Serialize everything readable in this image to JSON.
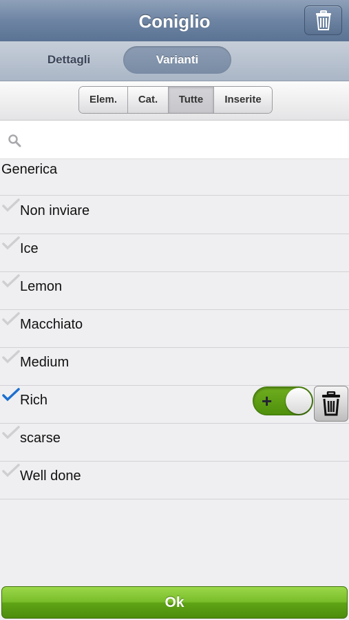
{
  "navbar": {
    "title": "Coniglio",
    "trash_icon": "trash-icon"
  },
  "tabs": [
    {
      "label": "Dettagli",
      "selected": false
    },
    {
      "label": "Varianti",
      "selected": true
    }
  ],
  "filters": [
    {
      "label": "Elem.",
      "selected": false
    },
    {
      "label": "Cat.",
      "selected": false
    },
    {
      "label": "Tutte",
      "selected": true
    },
    {
      "label": "Inserite",
      "selected": false
    }
  ],
  "search": {
    "placeholder": "",
    "value": "",
    "icon": "search-icon"
  },
  "category": {
    "title": "Generica"
  },
  "items": [
    {
      "label": "Non inviare",
      "checked": false
    },
    {
      "label": "Ice",
      "checked": false
    },
    {
      "label": "Lemon",
      "checked": false
    },
    {
      "label": "Macchiato",
      "checked": false
    },
    {
      "label": "Medium",
      "checked": false
    },
    {
      "label": "Rich",
      "checked": true,
      "toggle_symbol": "+",
      "toggle_on": true
    },
    {
      "label": "scarse",
      "checked": false
    },
    {
      "label": "Well done",
      "checked": false
    }
  ],
  "ok_button": {
    "label": "Ok"
  },
  "colors": {
    "navbar": "#6d84a3",
    "check_active": "#1c6fd0",
    "check_inactive": "#c9c9cc",
    "accent_green": "#5fa316"
  }
}
